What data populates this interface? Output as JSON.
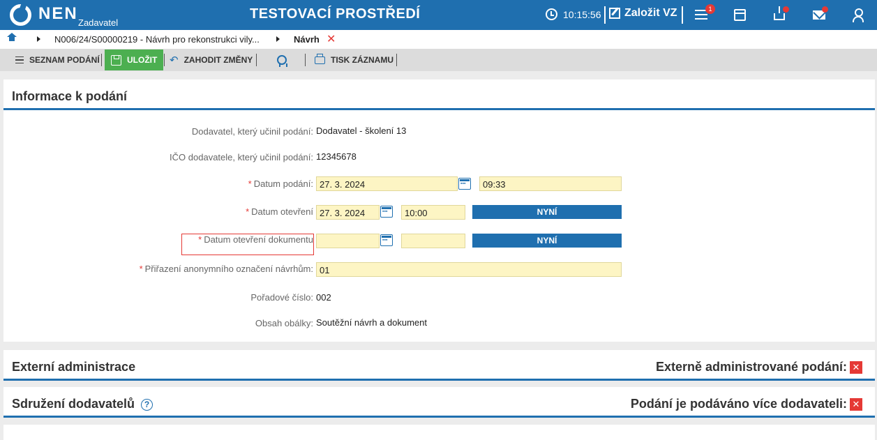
{
  "topbar": {
    "brand": "NEN",
    "brand_sub": "Zadavatel",
    "env_title": "TESTOVACÍ PROSTŘEDÍ",
    "time": "10:15:56",
    "create_label": "Založit VZ",
    "menu_badge": "1",
    "colors": {
      "bar": "#1f6faf",
      "badge": "#e53935"
    }
  },
  "breadcrumb": {
    "item1": "N006/24/S00000219 - Návrh pro rekonstrukci vily...",
    "item2": "Návrh",
    "close": "✕"
  },
  "toolbar": {
    "list_label": "SEZNAM PODÁNÍ",
    "save_label": "ULOŽIT",
    "discard_label": "ZAHODIT ZMĚNY",
    "print_label": "TISK ZÁZNAMU",
    "save_color": "#4caf50"
  },
  "info_panel": {
    "title": "Informace k podání",
    "supplier_label": "Dodavatel, který učinil podání:",
    "supplier_value": "Dodavatel - školení 13",
    "ico_label": "IČO dodavatele, který učinil podání:",
    "ico_value": "12345678",
    "submit_date_label": "Datum podání:",
    "submit_date": "27. 3. 2024",
    "submit_time": "09:33",
    "open_date_label": "Datum otevření",
    "open_date": "27. 3. 2024",
    "open_time": "10:00",
    "now_label": "NYNÍ",
    "doc_open_label": "Datum otevření dokumentu",
    "doc_open_date": "",
    "doc_open_time": "",
    "anon_label": "Přiřazení anonymního označení návrhům:",
    "anon_value": "01",
    "order_label": "Pořadové číslo:",
    "order_value": "002",
    "envelope_label": "Obsah obálky:",
    "envelope_value": "Soutěžní návrh a dokument",
    "required_mark": "*"
  },
  "external_panel": {
    "title": "Externí administrace",
    "right_label": "Externě administrované podání:",
    "value_icon": "x-icon"
  },
  "association_panel": {
    "title": "Sdružení dodavatelů",
    "help": "?",
    "right_label": "Podání je podáváno více dodavateli:",
    "value_icon": "x-icon"
  }
}
